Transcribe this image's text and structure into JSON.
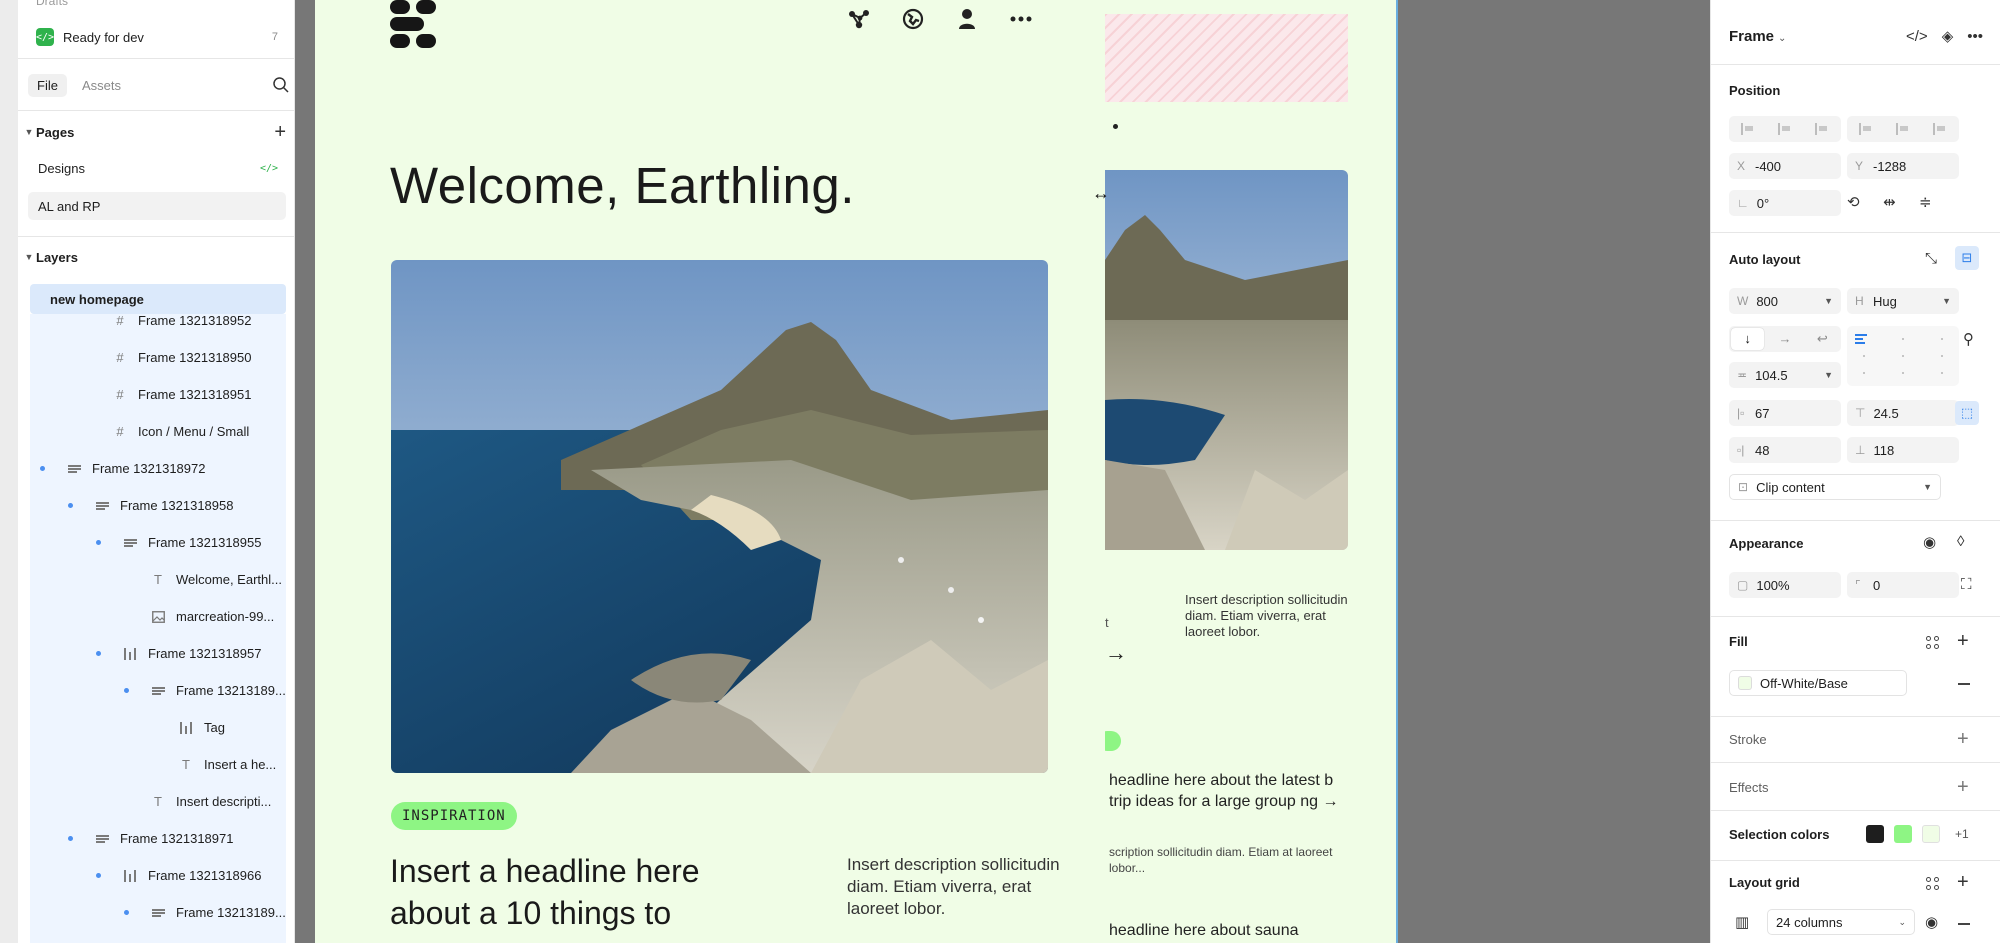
{
  "left_panel": {
    "drafts_label": "Drafts",
    "ready_for_dev": {
      "label": "Ready for dev",
      "count": "7",
      "icon": "code-icon"
    },
    "tabs": [
      {
        "label": "File",
        "active": true
      },
      {
        "label": "Assets",
        "active": false
      }
    ],
    "pages_header": "Pages",
    "pages": [
      {
        "label": "Designs",
        "dev_icon": "</>"
      },
      {
        "label": "AL and RP"
      }
    ],
    "layers_header": "Layers",
    "selected_layer": "new homepage",
    "layers": [
      {
        "label": "Frame 1321318952",
        "icon": "frame"
      },
      {
        "label": "Frame 1321318950",
        "icon": "frame"
      },
      {
        "label": "Frame 1321318951",
        "icon": "frame"
      },
      {
        "label": "Icon / Menu / Small",
        "icon": "frame"
      },
      {
        "label": "Frame 1321318972",
        "icon": "autolayout-v"
      },
      {
        "label": "Frame 1321318958",
        "icon": "autolayout-v"
      },
      {
        "label": "Frame 1321318955",
        "icon": "autolayout-v"
      },
      {
        "label": "Welcome, Earthl...",
        "icon": "text"
      },
      {
        "label": "marcreation-99...",
        "icon": "image"
      },
      {
        "label": "Frame 1321318957",
        "icon": "autolayout-h"
      },
      {
        "label": "Frame 13213189...",
        "icon": "autolayout-v"
      },
      {
        "label": "Tag",
        "icon": "autolayout-h"
      },
      {
        "label": "Insert a he...",
        "icon": "text"
      },
      {
        "label": "Insert descripti...",
        "icon": "text"
      },
      {
        "label": "Frame 1321318971",
        "icon": "autolayout-v"
      },
      {
        "label": "Frame 1321318966",
        "icon": "autolayout-h"
      },
      {
        "label": "Frame 13213189...",
        "icon": "autolayout-v"
      }
    ]
  },
  "canvas": {
    "hero_title": "Welcome, Earthling.",
    "tag": "INSPIRATION",
    "headline": "Insert a headline here about a 10 things to",
    "description": "Insert description sollicitudin diam. Etiam viverra, erat laoreet lobor.",
    "second_frame": {
      "description": "Insert description sollicitudin diam. Etiam viverra, erat laoreet lobor.",
      "arrow": "→",
      "tick": "t",
      "headline": "headline here about the latest b trip ideas for a large group ng →",
      "desc2": "scription sollicitudin diam. Etiam at laoreet lobor...",
      "headline2": "headline here about sauna"
    },
    "resize_cursor": "↔",
    "colors": {
      "frame_bg": "#f0fde6",
      "tag_bg": "#8ef584",
      "canvas_bg": "#777777"
    }
  },
  "right_panel": {
    "frame_label": "Frame",
    "position": {
      "header": "Position",
      "x_label": "X",
      "x": "-400",
      "y_label": "Y",
      "y": "-1288",
      "rotation": "0°"
    },
    "auto_layout": {
      "header": "Auto layout",
      "w_label": "W",
      "w": "800",
      "h_label": "H",
      "h": "Hug",
      "gap": "104.5",
      "padding_left": "67",
      "padding_top": "24.5",
      "padding_right": "48",
      "padding_bottom": "118",
      "clip": "Clip content",
      "direction_icons": [
        "↓",
        "→",
        "↩"
      ]
    },
    "appearance": {
      "header": "Appearance",
      "opacity": "100%",
      "radius": "0"
    },
    "fill": {
      "header": "Fill",
      "value": "Off-White/Base",
      "swatch": "#f0fde6"
    },
    "stroke_header": "Stroke",
    "effects_header": "Effects",
    "selection_colors": {
      "header": "Selection colors",
      "colors": [
        "#1e1e1e",
        "#8ef584",
        "#f0fde6"
      ],
      "more": "+1"
    },
    "layout_grid": {
      "header": "Layout grid",
      "value": "24 columns"
    }
  }
}
